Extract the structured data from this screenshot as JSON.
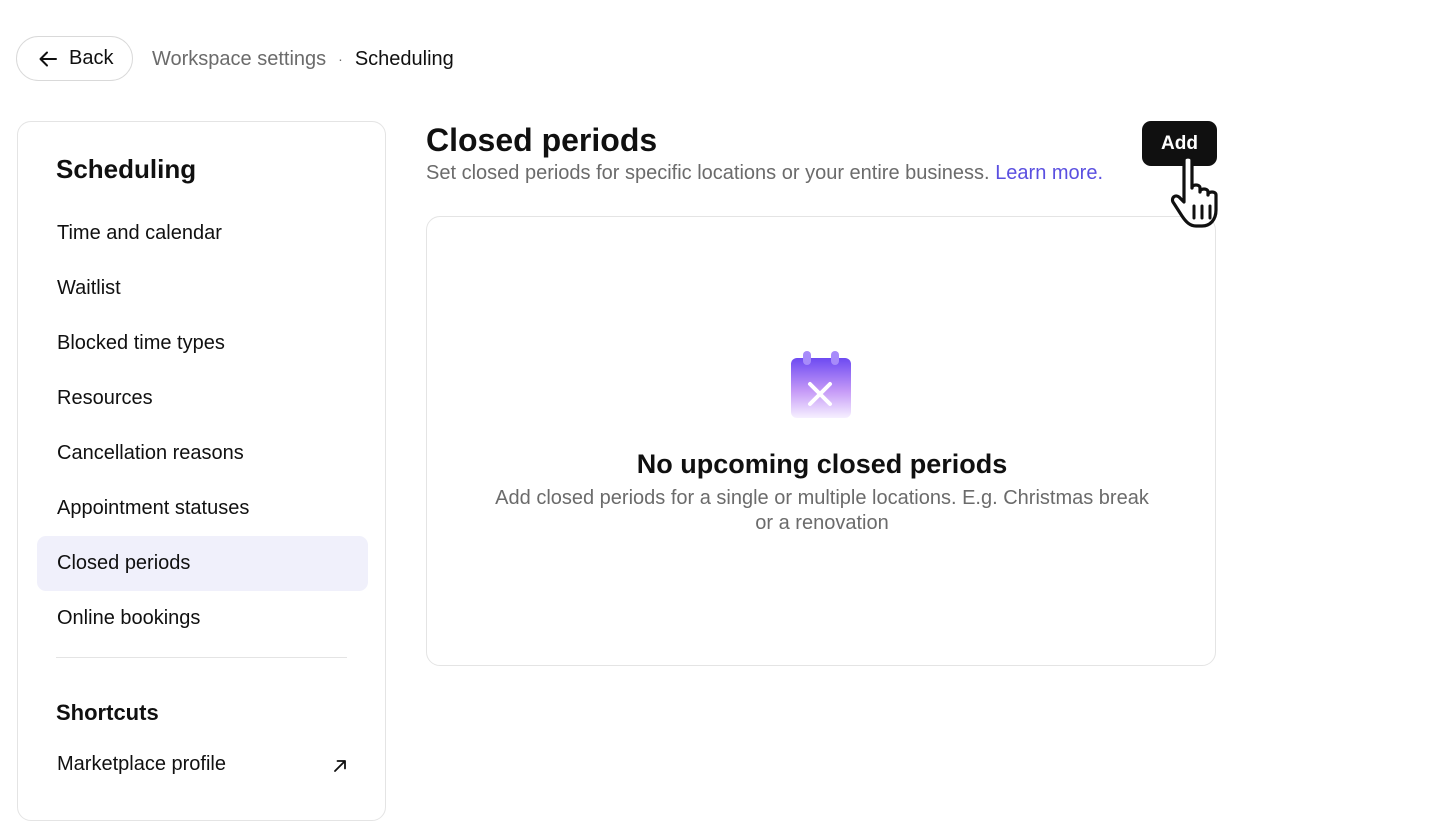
{
  "header": {
    "back_label": "Back",
    "breadcrumb": {
      "parent": "Workspace settings",
      "separator": "·",
      "current": "Scheduling"
    }
  },
  "sidebar": {
    "title": "Scheduling",
    "items": [
      {
        "label": "Time and calendar",
        "active": false
      },
      {
        "label": "Waitlist",
        "active": false
      },
      {
        "label": "Blocked time types",
        "active": false
      },
      {
        "label": "Resources",
        "active": false
      },
      {
        "label": "Cancellation reasons",
        "active": false
      },
      {
        "label": "Appointment statuses",
        "active": false
      },
      {
        "label": "Closed periods",
        "active": true
      },
      {
        "label": "Online bookings",
        "active": false
      }
    ],
    "shortcuts_title": "Shortcuts",
    "shortcuts": [
      {
        "label": "Marketplace profile",
        "icon": "external-link-icon"
      }
    ]
  },
  "main": {
    "title": "Closed periods",
    "subtitle": "Set closed periods for specific locations or your entire business.",
    "learn_more": "Learn more.",
    "add_label": "Add",
    "empty_state": {
      "icon": "calendar-closed-icon",
      "title": "No upcoming closed periods",
      "description": "Add closed periods for a single or multiple locations. E.g. Christmas break or a renovation"
    }
  },
  "colors": {
    "accent": "#5a4fe0",
    "active_nav_bg": "#f0f0fb",
    "primary_button": "#101010",
    "muted_text": "#6b6b6b",
    "border": "#e4e4e4"
  }
}
